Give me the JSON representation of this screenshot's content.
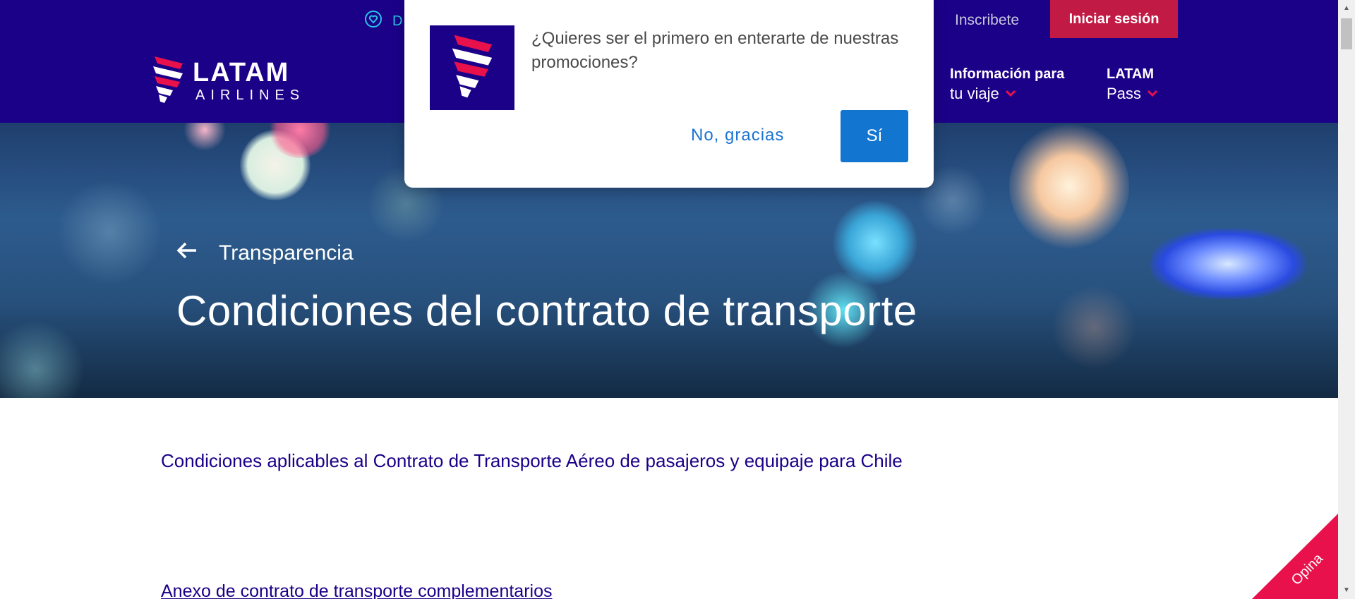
{
  "topbar": {
    "promo_text": "D",
    "register_label": "Inscribete",
    "login_label": "Iniciar sesión"
  },
  "header": {
    "logo_line1": "LATAM",
    "logo_line2": "AIRLINES",
    "nav": [
      {
        "line1": "Información para",
        "line2": "tu viaje"
      },
      {
        "line1": "LATAM",
        "line2": "Pass"
      }
    ]
  },
  "hero": {
    "back_label": "Transparencia",
    "title": "Condiciones del contrato de transporte"
  },
  "content": {
    "heading": "Condiciones aplicables al Contrato de Transporte Aéreo de pasajeros y equipaje para Chile",
    "link": "Anexo de contrato de transporte complementarios"
  },
  "feedback": {
    "label": "Opina"
  },
  "modal": {
    "question": "¿Quieres ser el primero en enterarte de nuestras promociones?",
    "decline_label": "No, gracias",
    "accept_label": "Sí"
  },
  "colors": {
    "brand_indigo": "#1b0088",
    "brand_red": "#e8114b",
    "login_red": "#c01a45",
    "accept_blue": "#1275d0"
  },
  "icons": [
    "heart-hand-icon",
    "chevron-down-icon",
    "arrow-left-icon",
    "latam-logo-icon"
  ]
}
